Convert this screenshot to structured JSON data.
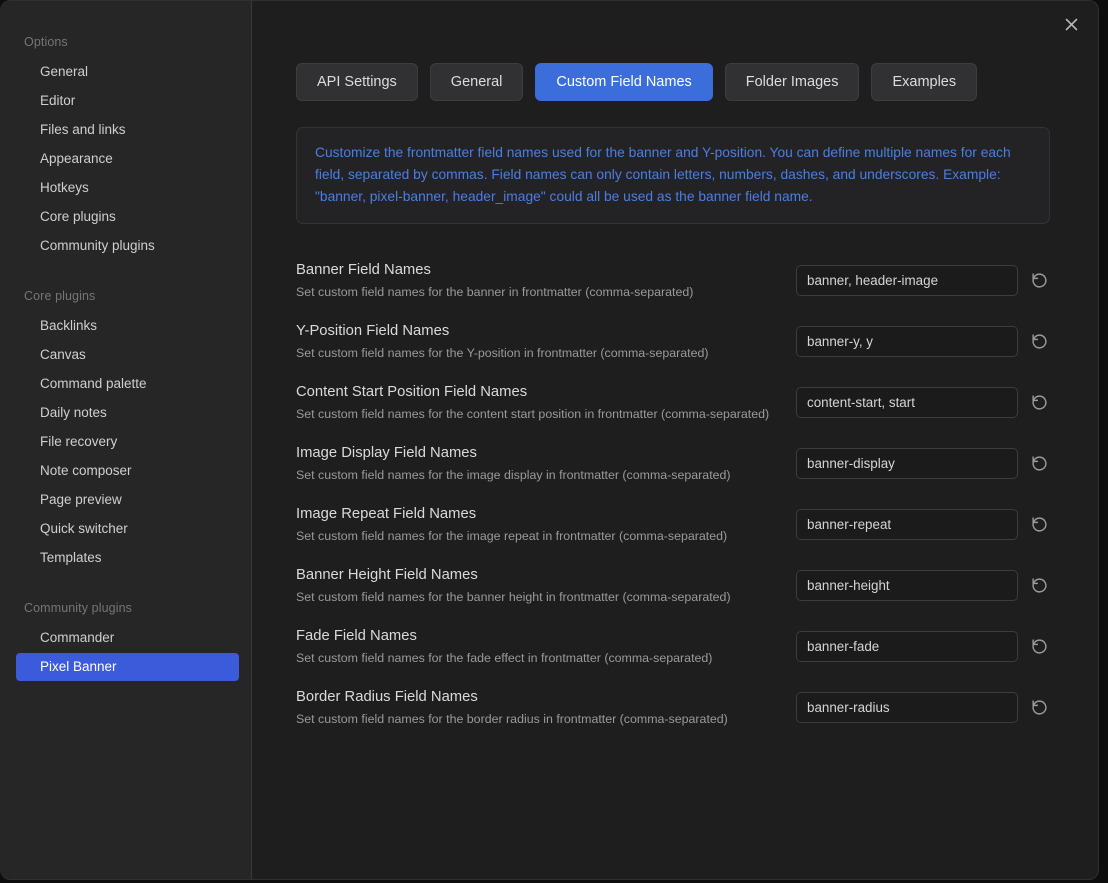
{
  "window": {
    "close_label": "✕"
  },
  "sidebar": {
    "sections": [
      {
        "heading": "Options",
        "items": [
          {
            "label": "General",
            "active": false
          },
          {
            "label": "Editor",
            "active": false
          },
          {
            "label": "Files and links",
            "active": false
          },
          {
            "label": "Appearance",
            "active": false
          },
          {
            "label": "Hotkeys",
            "active": false
          },
          {
            "label": "Core plugins",
            "active": false
          },
          {
            "label": "Community plugins",
            "active": false
          }
        ]
      },
      {
        "heading": "Core plugins",
        "items": [
          {
            "label": "Backlinks",
            "active": false
          },
          {
            "label": "Canvas",
            "active": false
          },
          {
            "label": "Command palette",
            "active": false
          },
          {
            "label": "Daily notes",
            "active": false
          },
          {
            "label": "File recovery",
            "active": false
          },
          {
            "label": "Note composer",
            "active": false
          },
          {
            "label": "Page preview",
            "active": false
          },
          {
            "label": "Quick switcher",
            "active": false
          },
          {
            "label": "Templates",
            "active": false
          }
        ]
      },
      {
        "heading": "Community plugins",
        "items": [
          {
            "label": "Commander",
            "active": false
          },
          {
            "label": "Pixel Banner",
            "active": true
          }
        ]
      }
    ]
  },
  "main": {
    "tabs": [
      {
        "label": "API Settings",
        "active": false
      },
      {
        "label": "General",
        "active": false
      },
      {
        "label": "Custom Field Names",
        "active": true
      },
      {
        "label": "Folder Images",
        "active": false
      },
      {
        "label": "Examples",
        "active": false
      }
    ],
    "info_text": "Customize the frontmatter field names used for the banner and Y-position. You can define multiple names for each field, separated by commas. Field names can only contain letters, numbers, dashes, and underscores. Example: \"banner, pixel-banner, header_image\" could all be used as the banner field name.",
    "settings": [
      {
        "name": "Banner Field Names",
        "description": "Set custom field names for the banner in frontmatter (comma-separated)",
        "value": "banner, header-image"
      },
      {
        "name": "Y-Position Field Names",
        "description": "Set custom field names for the Y-position in frontmatter (comma-separated)",
        "value": "banner-y, y"
      },
      {
        "name": "Content Start Position Field Names",
        "description": "Set custom field names for the content start position in frontmatter (comma-separated)",
        "value": "content-start, start"
      },
      {
        "name": "Image Display Field Names",
        "description": "Set custom field names for the image display in frontmatter (comma-separated)",
        "value": "banner-display"
      },
      {
        "name": "Image Repeat Field Names",
        "description": "Set custom field names for the image repeat in frontmatter (comma-separated)",
        "value": "banner-repeat"
      },
      {
        "name": "Banner Height Field Names",
        "description": "Set custom field names for the banner height in frontmatter (comma-separated)",
        "value": "banner-height"
      },
      {
        "name": "Fade Field Names",
        "description": "Set custom field names for the fade effect in frontmatter (comma-separated)",
        "value": "banner-fade"
      },
      {
        "name": "Border Radius Field Names",
        "description": "Set custom field names for the border radius in frontmatter (comma-separated)",
        "value": "banner-radius"
      }
    ]
  },
  "colors": {
    "accent": "#3b6ddb",
    "sidebar_active": "#3b5bdb",
    "info_text": "#4c7ee0",
    "modal_bg": "#1e1e1f",
    "sidebar_bg": "#262627"
  }
}
